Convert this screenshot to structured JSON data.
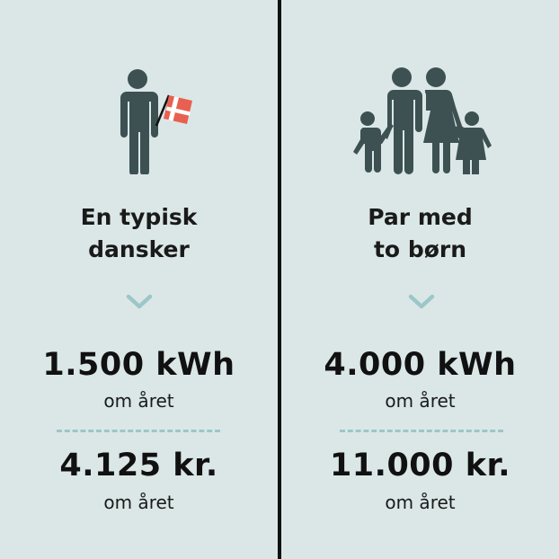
{
  "colors": {
    "background": "#dbe7e7",
    "figure": "#3d5153",
    "flag_red": "#e8604f",
    "accent": "#9dc6c9",
    "divider": "#111111"
  },
  "left": {
    "icon": "person-with-danish-flag-icon",
    "title_line1": "En typisk",
    "title_line2": "dansker",
    "kwh": "1.500 kWh",
    "kwh_unit": "om året",
    "cost": "4.125 kr.",
    "cost_unit": "om året"
  },
  "right": {
    "icon": "family-icon",
    "title_line1": "Par med",
    "title_line2": "to børn",
    "kwh": "4.000 kWh",
    "kwh_unit": "om året",
    "cost": "11.000 kr.",
    "cost_unit": "om året"
  }
}
